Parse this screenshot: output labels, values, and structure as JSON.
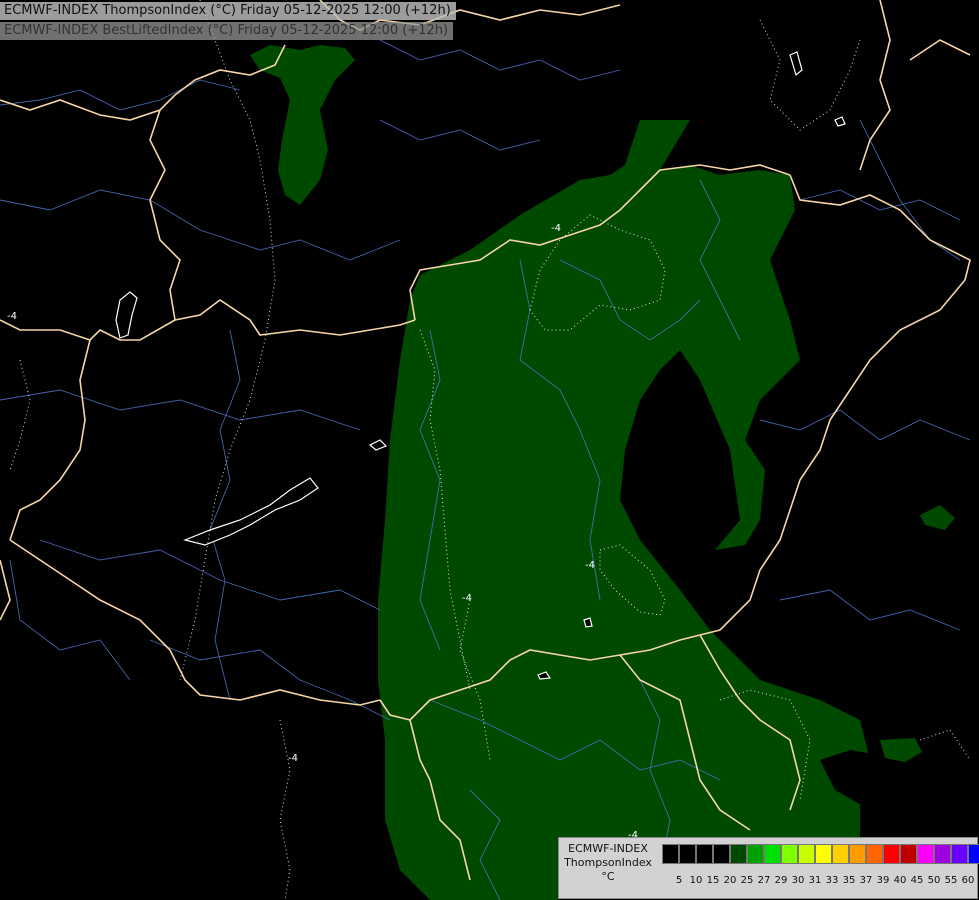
{
  "header": {
    "line1": "ECMWF-INDEX ThompsonIndex (°C) Friday 05-12-2025 12:00 (+12h)",
    "line2": "ECMWF-INDEX BestLiftedIndex (°C) Friday 05-12-2025 12:00 (+12h)"
  },
  "contour_labels": [
    "-4",
    "-4",
    "-4",
    "-4",
    "-4",
    "-4"
  ],
  "colors": {
    "background": "#000000",
    "field_fill": "#004a00",
    "country_border": "#f6d6a6",
    "region_border": "#4a6fbf",
    "lake_outline": "#ffffff",
    "lifted_index_contour": "#ffffff"
  },
  "legend": {
    "title_line1": "ECMWF-INDEX",
    "title_line2": "ThompsonIndex",
    "unit": "°C",
    "ticks": [
      "5",
      "10",
      "15",
      "20",
      "25",
      "27",
      "29",
      "30",
      "31",
      "33",
      "35",
      "37",
      "39",
      "40",
      "45",
      "50",
      "55",
      "60"
    ],
    "colors": [
      "#000000",
      "#000000",
      "#000000",
      "#000000",
      "#004a00",
      "#00a000",
      "#00e000",
      "#80ff00",
      "#c8ff00",
      "#ffff00",
      "#ffd000",
      "#ff9c00",
      "#ff6400",
      "#ff0000",
      "#c00000",
      "#ff00ff",
      "#a000e0",
      "#6a00ff",
      "#0000ff"
    ]
  }
}
